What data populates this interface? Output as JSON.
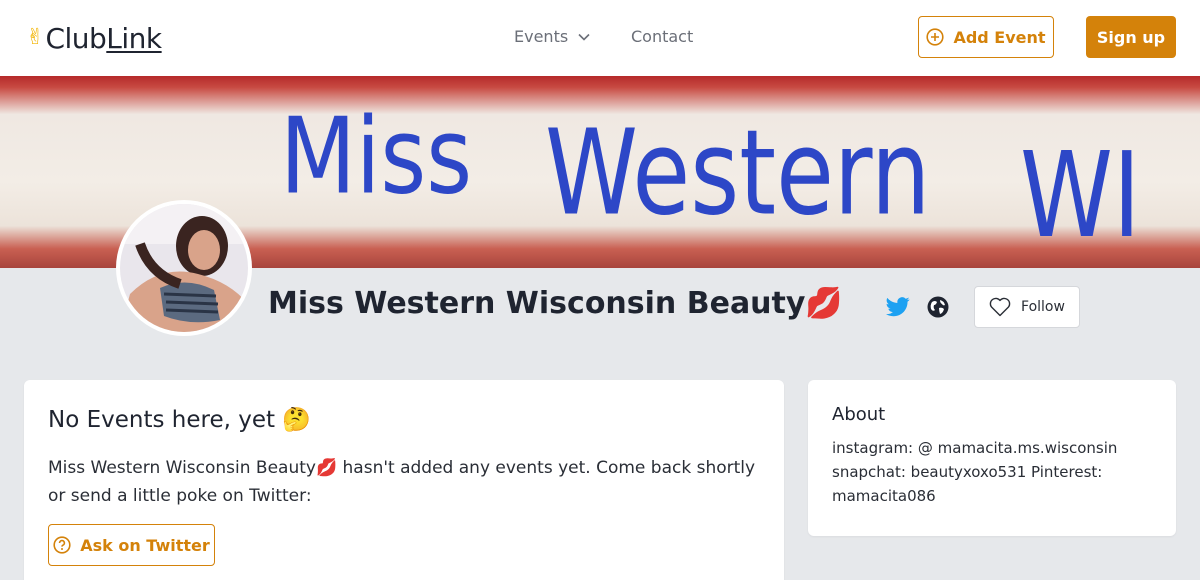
{
  "header": {
    "logo_text_club": "Club",
    "logo_text_link": "Link",
    "nav_events": "Events",
    "nav_contact": "Contact",
    "add_event_label": "Add Event",
    "signup_label": "Sign up"
  },
  "banner": {
    "sash_line1": "Miss",
    "sash_line2": "Western",
    "sash_line3": "WI"
  },
  "profile": {
    "name": "Miss Western Wisconsin Beauty💋",
    "follow_label": "Follow"
  },
  "events_card": {
    "heading": "No Events here, yet 🤔",
    "message": "Miss Western Wisconsin Beauty💋 hasn't added any events yet. Come back shortly or send a little poke on Twitter:",
    "ask_label": "Ask on Twitter"
  },
  "about_card": {
    "heading": "About",
    "body": "instagram: @ mamacita.ms.wisconsin snapchat: beautyxoxo531 Pinterest: mamacita086"
  },
  "colors": {
    "accent": "#d4820a",
    "twitter": "#1da1f2",
    "page_bg": "#e6e8eb"
  }
}
